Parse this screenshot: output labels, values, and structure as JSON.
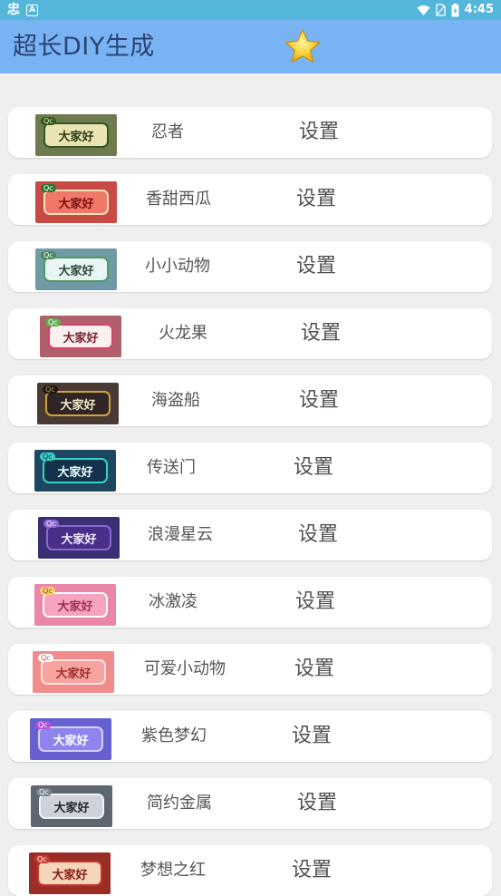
{
  "status_bar": {
    "time": "4:45",
    "app_glyph": "忠",
    "a_glyph": "A",
    "icons": [
      "wifi-icon",
      "no-sim-icon",
      "battery-icon"
    ]
  },
  "header": {
    "title": "超长DIY生成",
    "star_icon": "star-icon",
    "background_color": "#7ab3f3"
  },
  "set_label": "设置",
  "preview_text": "大家好",
  "badge_text": "Qc",
  "items": [
    {
      "name": "忍者",
      "thumb_bg": "#6f7a4e",
      "bubble_bg": "#e9e4b2",
      "bubble_border": "#2f5a1f",
      "bubble_color": "#2a3a14",
      "badge_bg": "#2f5a1f",
      "badge_color": "#e9e4b2"
    },
    {
      "name": "香甜西瓜",
      "thumb_bg": "#c84a44",
      "bubble_bg": "#f07868",
      "bubble_border": "#fbe2b8",
      "bubble_color": "#7a1010",
      "badge_bg": "#2e7a32",
      "badge_color": "#ffffff"
    },
    {
      "name": "小小动物",
      "thumb_bg": "#6f9aa6",
      "bubble_bg": "#e9f4f4",
      "bubble_border": "#4f9a60",
      "bubble_color": "#2a4a3a",
      "badge_bg": "#4a8a5a",
      "badge_color": "#ffffff"
    },
    {
      "name": "火龙果",
      "thumb_bg": "#b0606a",
      "bubble_bg": "#fbf0ee",
      "bubble_border": "#d4426e",
      "bubble_color": "#7a2030",
      "badge_bg": "#5ab04a",
      "badge_color": "#ffffff"
    },
    {
      "name": "海盗船",
      "thumb_bg": "#4a3a34",
      "bubble_bg": "#2e2524",
      "bubble_border": "#d4a13a",
      "bubble_color": "#f0e6c8",
      "badge_bg": "#1a1412",
      "badge_color": "#d4a13a"
    },
    {
      "name": "传送门",
      "thumb_bg": "#1e4660",
      "bubble_bg": "#14324a",
      "bubble_border": "#36d2c8",
      "bubble_color": "#e6fbff",
      "badge_bg": "#36d2c8",
      "badge_color": "#0e2a3a"
    },
    {
      "name": "浪漫星云",
      "thumb_bg": "#3a2e74",
      "bubble_bg": "#4a2e8a",
      "bubble_border": "#8a68d0",
      "bubble_color": "#f3eaff",
      "badge_bg": "#8a68d0",
      "badge_color": "#ffffff"
    },
    {
      "name": "冰激凌",
      "thumb_bg": "#ea86a8",
      "bubble_bg": "#f6a4c2",
      "bubble_border": "#ffffff",
      "bubble_color": "#a0304e",
      "badge_bg": "#fcd46a",
      "badge_color": "#a0304e"
    },
    {
      "name": "可爱小动物",
      "thumb_bg": "#f28b8b",
      "bubble_bg": "#f7a4a0",
      "bubble_border": "#fde2e0",
      "bubble_color": "#a0302c",
      "badge_bg": "#ffffff",
      "badge_color": "#d0504c"
    },
    {
      "name": "紫色梦幻",
      "thumb_bg": "#6660d0",
      "bubble_bg": "#8f84ee",
      "bubble_border": "#d6d0ff",
      "bubble_color": "#ffffff",
      "badge_bg": "#b54edc",
      "badge_color": "#ffffff"
    },
    {
      "name": "简约金属",
      "thumb_bg": "#5e6670",
      "bubble_bg": "#cdd3da",
      "bubble_border": "#f0f3f6",
      "bubble_color": "#22262a",
      "badge_bg": "#7c8690",
      "badge_color": "#ffffff"
    },
    {
      "name": "梦想之红",
      "thumb_bg": "#9a2e26",
      "bubble_bg": "#f4d6b8",
      "bubble_border": "#c8362c",
      "bubble_color": "#8a1a12",
      "badge_bg": "#c8362c",
      "badge_color": "#ffffff"
    }
  ]
}
